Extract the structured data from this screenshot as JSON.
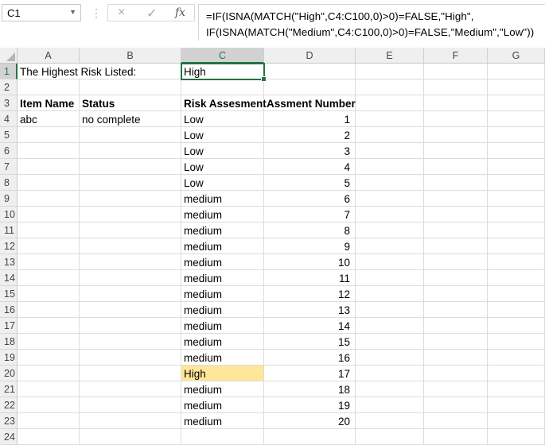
{
  "name_box": {
    "value": "C1"
  },
  "formula_bar": {
    "cancel_icon": "×",
    "enter_icon": "✓",
    "fx_label": "fx",
    "formula": "=IF(ISNA(MATCH(\"High\",C4:C100,0)>0)=FALSE,\"High\",\nIF(ISNA(MATCH(\"Medium\",C4:C100,0)>0)=FALSE,\"Medium\",\"Low\"))"
  },
  "grid": {
    "columns": [
      "A",
      "B",
      "C",
      "D",
      "E",
      "F",
      "G"
    ],
    "selected_column": "C",
    "selected_row": "1",
    "highlight_color": "#ffe699",
    "accent_color": "#217346",
    "rows": [
      {
        "num": "1",
        "A": "The Highest Risk Listed:",
        "B": "",
        "C": "High",
        "D": ""
      },
      {
        "num": "2",
        "A": "",
        "B": "",
        "C": "",
        "D": ""
      },
      {
        "num": "3",
        "A": "Item Name",
        "B": "Status",
        "C": "Risk Assesment",
        "D": "Assment Number",
        "bold": true
      },
      {
        "num": "4",
        "A": "abc",
        "B": "no complete",
        "C": "Low",
        "D": "1"
      },
      {
        "num": "5",
        "A": "",
        "B": "",
        "C": "Low",
        "D": "2"
      },
      {
        "num": "6",
        "A": "",
        "B": "",
        "C": "Low",
        "D": "3"
      },
      {
        "num": "7",
        "A": "",
        "B": "",
        "C": "Low",
        "D": "4"
      },
      {
        "num": "8",
        "A": "",
        "B": "",
        "C": "Low",
        "D": "5"
      },
      {
        "num": "9",
        "A": "",
        "B": "",
        "C": "medium",
        "D": "6"
      },
      {
        "num": "10",
        "A": "",
        "B": "",
        "C": "medium",
        "D": "7"
      },
      {
        "num": "11",
        "A": "",
        "B": "",
        "C": "medium",
        "D": "8"
      },
      {
        "num": "12",
        "A": "",
        "B": "",
        "C": "medium",
        "D": "9"
      },
      {
        "num": "13",
        "A": "",
        "B": "",
        "C": "medium",
        "D": "10"
      },
      {
        "num": "14",
        "A": "",
        "B": "",
        "C": "medium",
        "D": "11"
      },
      {
        "num": "15",
        "A": "",
        "B": "",
        "C": "medium",
        "D": "12"
      },
      {
        "num": "16",
        "A": "",
        "B": "",
        "C": "medium",
        "D": "13"
      },
      {
        "num": "17",
        "A": "",
        "B": "",
        "C": "medium",
        "D": "14"
      },
      {
        "num": "18",
        "A": "",
        "B": "",
        "C": "medium",
        "D": "15"
      },
      {
        "num": "19",
        "A": "",
        "B": "",
        "C": "medium",
        "D": "16"
      },
      {
        "num": "20",
        "A": "",
        "B": "",
        "C": "High",
        "D": "17",
        "highlight": true
      },
      {
        "num": "21",
        "A": "",
        "B": "",
        "C": "medium",
        "D": "18"
      },
      {
        "num": "22",
        "A": "",
        "B": "",
        "C": "medium",
        "D": "19"
      },
      {
        "num": "23",
        "A": "",
        "B": "",
        "C": "medium",
        "D": "20"
      },
      {
        "num": "24",
        "A": "",
        "B": "",
        "C": "",
        "D": ""
      }
    ]
  }
}
